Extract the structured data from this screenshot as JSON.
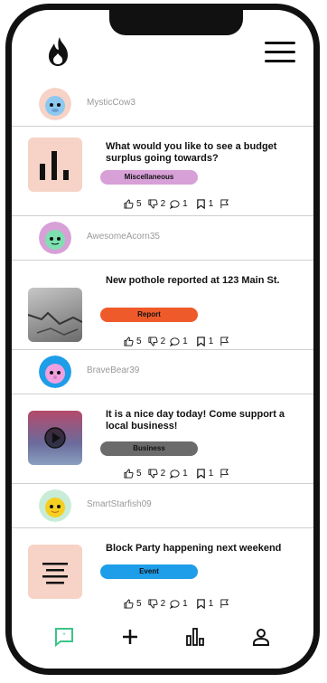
{
  "header": {
    "logo": "flame-logo",
    "menu_icon": "hamburger-menu-icon"
  },
  "posts": [
    {
      "user": "MysticCow3",
      "title": "What would you like to see a budget surplus going towards?",
      "tag": "Miscellaneous",
      "tag_color": "#d7a0d7",
      "likes": "5",
      "dislikes": "2",
      "comments": "1",
      "saves": "1"
    },
    {
      "user": "AwesomeAcorn35",
      "title": "New pothole reported at 123 Main St.",
      "tag": "Report",
      "tag_color": "#ef5a2b",
      "likes": "5",
      "dislikes": "2",
      "comments": "1",
      "saves": "1"
    },
    {
      "user": "BraveBear39",
      "title": "It is a nice day today! Come support a local business!",
      "tag": "Business",
      "tag_color": "#6b6b6b",
      "likes": "5",
      "dislikes": "2",
      "comments": "1",
      "saves": "1"
    },
    {
      "user": "SmartStarfish09",
      "title": "Block Party happening next weekend",
      "tag": "Event",
      "tag_color": "#1e9de8",
      "likes": "5",
      "dislikes": "2",
      "comments": "1",
      "saves": "1"
    }
  ],
  "bottom_nav": [
    "chat-icon",
    "plus-icon",
    "bar-chart-icon",
    "profile-icon"
  ]
}
